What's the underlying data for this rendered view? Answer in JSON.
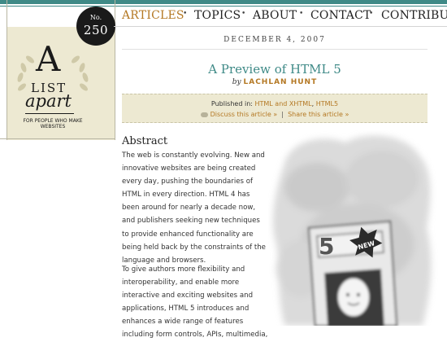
{
  "nav": {
    "items": [
      {
        "label": "ARTICLES",
        "active": true
      },
      {
        "label": "TOPICS",
        "active": false
      },
      {
        "label": "ABOUT",
        "active": false
      },
      {
        "label": "CONTACT",
        "active": false
      },
      {
        "label": "CONTRIBUTE",
        "active": false
      }
    ],
    "separator": "•"
  },
  "logo": {
    "issue_prefix": "No.",
    "issue_number": "250",
    "letter": "A",
    "word1": "LIST",
    "word2": "apart",
    "tagline": "FOR PEOPLE WHO MAKE WEBSITES"
  },
  "article": {
    "date": "DECEMBER 4, 2007",
    "title": "A Preview of HTML 5",
    "by": "by",
    "author": "LACHLAN HUNT",
    "published_in_label": "Published in:",
    "topics": [
      "HTML and XHTML",
      "HTML5"
    ],
    "topic_separator": ", ",
    "discuss_link": "Discuss this article »",
    "link_separator": "|",
    "share_link": "Share this article »",
    "abstract_heading": "Abstract",
    "paragraph1": "The web is constantly evolving. New and innovative websites are being created every day, pushing the boundaries of HTML in every direction. HTML 4 has been around for nearly a decade now, and publishers seeking new techniques to provide enhanced functionality are being held back by the constraints of the language and browsers.",
    "paragraph2": "To give authors more flexibility and interoperability, and enable more interactive and exciting websites and applications, HTML 5 introduces and enhances a wide range of features including form controls, APIs, multimedia,"
  },
  "illustration": {
    "sign_number": "5",
    "badge_text": "NEW"
  },
  "colors": {
    "accent_teal": "#3f8a87",
    "accent_orange": "#b47823",
    "panel_beige": "#ede9d2"
  }
}
